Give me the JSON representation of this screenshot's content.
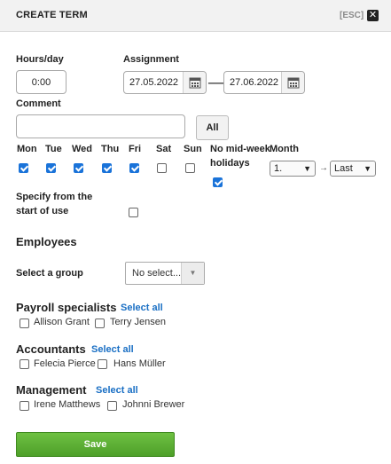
{
  "header": {
    "title": "CREATE TERM",
    "esc_label": "[ESC]",
    "close_icon": "close-icon"
  },
  "form": {
    "hours_label": "Hours/day",
    "hours_value": "0:00",
    "assignment_label": "Assignment",
    "date_from": "27.05.2022",
    "date_to": "27.06.2022",
    "arrow": "⟶",
    "comment_label": "Comment",
    "comment_value": "",
    "all_button": "All",
    "days": [
      {
        "label": "Mon",
        "checked": true
      },
      {
        "label": "Tue",
        "checked": true
      },
      {
        "label": "Wed",
        "checked": true
      },
      {
        "label": "Thu",
        "checked": true
      },
      {
        "label": "Fri",
        "checked": true
      },
      {
        "label": "Sat",
        "checked": false
      },
      {
        "label": "Sun",
        "checked": false
      }
    ],
    "no_midweek_label_1": "No mid-week",
    "no_midweek_label_2": "holidays",
    "no_midweek_checked": true,
    "month_label": "Month",
    "month_from": "1.",
    "month_arrow": "→",
    "month_to": "Last",
    "specify_label_1": "Specify from the",
    "specify_label_2": "start of use",
    "specify_checked": false
  },
  "employees": {
    "heading": "Employees",
    "group_label": "Select a group",
    "group_placeholder": "No select...",
    "groups": [
      {
        "name": "Payroll specialists",
        "select_all": "Select all",
        "people": [
          "Allison Grant",
          "Terry Jensen"
        ]
      },
      {
        "name": "Accountants",
        "select_all": "Select all",
        "people": [
          "Felecia Pierce",
          "Hans Müller"
        ]
      },
      {
        "name": "Management",
        "select_all": "Select all",
        "people": [
          "Irene Matthews",
          "Johnni Brewer"
        ]
      }
    ]
  },
  "footer": {
    "save_label": "Save"
  },
  "colors": {
    "accent": "#1a73d9",
    "link": "#1a6fc4",
    "save": "#5cb033"
  }
}
